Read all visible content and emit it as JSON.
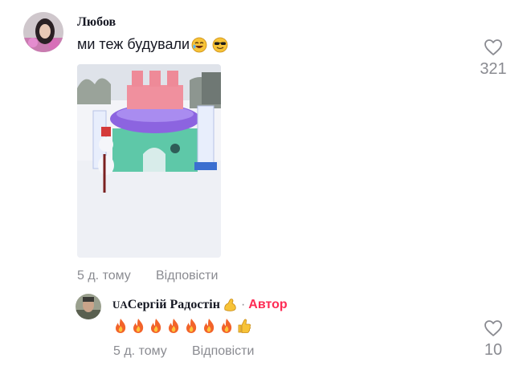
{
  "comments": [
    {
      "username": "Любов",
      "text": "ми теж будували",
      "emojis": [
        "rolling-laughing-emoji",
        "sunglasses-emoji"
      ],
      "time": "5 д. тому",
      "reply_label": "Відповісти",
      "likes": "321"
    }
  ],
  "reply": {
    "flag": "UA",
    "username": "Сергій Радостін",
    "flexed_emoji": "flexed-biceps-emoji",
    "separator": "·",
    "author_label": "Автор",
    "emojis": [
      "fire-emoji",
      "fire-emoji",
      "fire-emoji",
      "fire-emoji",
      "fire-emoji",
      "fire-emoji",
      "fire-emoji",
      "thumbs-up-emoji"
    ],
    "time": "5 д. тому",
    "reply_label": "Відповісти",
    "likes": "10"
  },
  "colors": {
    "author": "#fe2c55",
    "muted": "#8a8b91",
    "text": "#161823"
  }
}
